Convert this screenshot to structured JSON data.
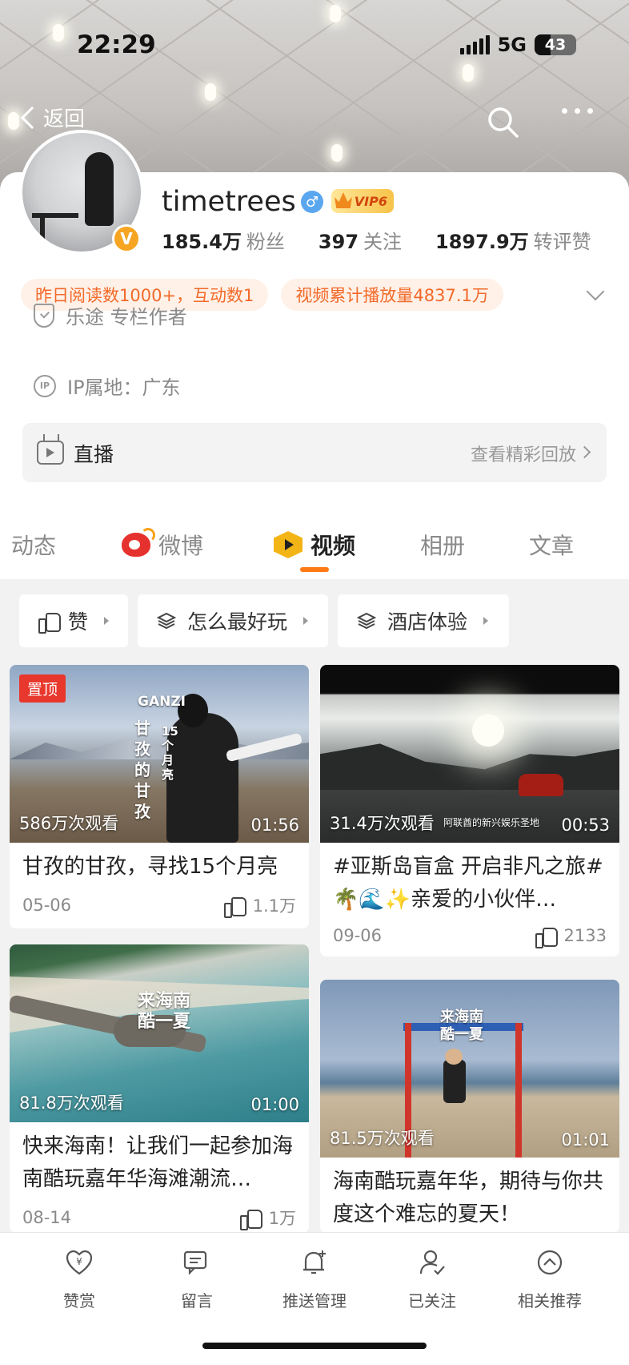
{
  "status_bar": {
    "time": "22:29",
    "network": "5G",
    "battery": "43"
  },
  "nav": {
    "back_label": "返回"
  },
  "profile": {
    "username": "timetrees",
    "gender": "♂",
    "vip": "VIP6",
    "verify": "V",
    "stats": [
      {
        "value": "185.4万",
        "label": "粉丝"
      },
      {
        "value": "397",
        "label": "关注"
      },
      {
        "value": "1897.9万",
        "label": "转评赞"
      }
    ],
    "tags": [
      "昨日阅读数1000+，互动数1",
      "视频累计播放量4837.1万"
    ],
    "certification": "乐途 专栏作者",
    "ip_location": "IP属地：广东",
    "live": {
      "label": "直播",
      "replay": "查看精彩回放"
    }
  },
  "tabs": [
    {
      "label": "动态"
    },
    {
      "label": "微博"
    },
    {
      "label": "视频",
      "active": true
    },
    {
      "label": "相册"
    },
    {
      "label": "文章"
    }
  ],
  "filters": [
    "赞",
    "怎么最好玩",
    "酒店体验"
  ],
  "videos": [
    {
      "pinned": "置顶",
      "views": "586万次观看",
      "duration": "01:56",
      "title": "甘孜的甘孜，寻找15个月亮",
      "date": "05-06",
      "likes": "1.1万",
      "overlay": "甘孜的甘孜",
      "overlay2": "15个月亮",
      "overlay3": "GANZI"
    },
    {
      "views": "31.4万次观看",
      "duration": "00:53",
      "title": "#亚斯岛盲盒 开启非凡之旅# 🌴🌊✨亲爱的小伙伴…",
      "date": "09-06",
      "likes": "2133",
      "overlay": "阿联酋的新兴娱乐圣地"
    },
    {
      "views": "81.8万次观看",
      "duration": "01:00",
      "title": "快来海南！让我们一起参加海南酷玩嘉年华海滩潮流…",
      "date": "08-14",
      "likes": "1万",
      "overlay": "来海南酷一夏"
    },
    {
      "views": "81.5万次观看",
      "duration": "01:01",
      "title": "海南酷玩嘉年华，期待与你共度这个难忘的夏天！",
      "overlay": "来海南酷一夏"
    }
  ],
  "bottom_bar": [
    {
      "label": "赞赏",
      "icon": "reward-icon"
    },
    {
      "label": "留言",
      "icon": "message-icon"
    },
    {
      "label": "推送管理",
      "icon": "bell-plus-icon"
    },
    {
      "label": "已关注",
      "icon": "user-check-icon"
    },
    {
      "label": "相关推荐",
      "icon": "chevron-up-circle-icon"
    }
  ],
  "colors": {
    "accent": "#ff7a16",
    "tag_text": "#f26a2a",
    "tag_bg": "#fff1e8",
    "pin": "#e8372c"
  }
}
